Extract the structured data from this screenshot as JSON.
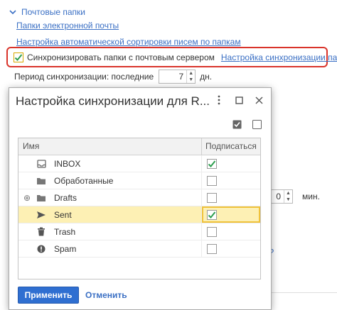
{
  "background": {
    "group_title": "Почтовые папки",
    "links": [
      "Папки электронной почты",
      "Настройка автоматической сортировки писем по папкам"
    ],
    "sync": {
      "checkbox_label": "Синхронизировать папки с почтовым сервером",
      "checked": true,
      "settings_link": "Настройка синхронизации папок"
    },
    "period": {
      "label": "Период синхронизации: последние",
      "value": "7",
      "unit": "дн."
    },
    "hidden_spin_value": "0",
    "hidden_spin_unit": "мин.",
    "help_glyph": "?"
  },
  "dialog": {
    "title": "Настройка синхронизации для R...",
    "columns": {
      "name": "Имя",
      "subscribe": "Подписаться"
    },
    "rows": [
      {
        "name": "INBOX",
        "icon": "inbox-icon",
        "expandable": false,
        "subscribed": true,
        "selected": false
      },
      {
        "name": "Обработанные",
        "icon": "folder-icon",
        "expandable": false,
        "subscribed": false,
        "selected": false
      },
      {
        "name": "Drafts",
        "icon": "drafts-icon",
        "expandable": true,
        "subscribed": false,
        "selected": false
      },
      {
        "name": "Sent",
        "icon": "sent-icon",
        "expandable": false,
        "subscribed": true,
        "selected": true
      },
      {
        "name": "Trash",
        "icon": "trash-icon",
        "expandable": false,
        "subscribed": false,
        "selected": false
      },
      {
        "name": "Spam",
        "icon": "spam-icon",
        "expandable": false,
        "subscribed": false,
        "selected": false
      }
    ],
    "apply_label": "Применить",
    "cancel_label": "Отменить"
  },
  "colors": {
    "accent": "#2f6fd1",
    "link": "#3a6fc4",
    "highlight_border": "#d9342b",
    "selection": "#fdf0b4",
    "check": "#2e9e4f"
  }
}
